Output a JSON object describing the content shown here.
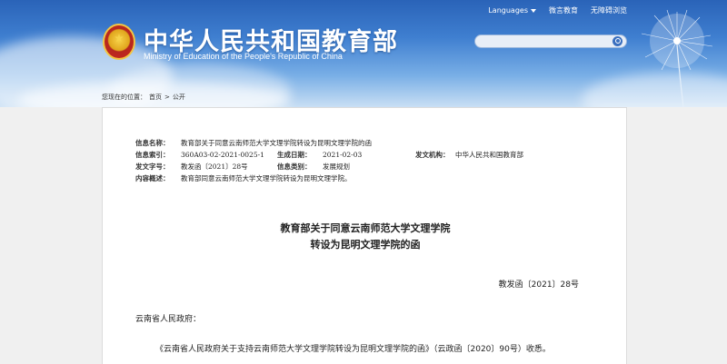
{
  "header": {
    "title": "中华人民共和国教育部",
    "subtitle": "Ministry of Education of the People's Republic of China",
    "links": {
      "languages": "Languages",
      "weibo": "微言教育",
      "accessible": "无障碍浏览"
    },
    "search": {
      "placeholder": ""
    }
  },
  "breadcrumb": {
    "prefix": "您现在的位置：",
    "home": "首页",
    "separator": ">",
    "current": "公开"
  },
  "info": {
    "name_label": "信息名称：",
    "name_value": "教育部关于同意云南师范大学文理学院转设为昆明文理学院的函",
    "index_label": "信息索引：",
    "index_value": "360A03-02-2021-0025-1",
    "date_label": "生成日期：",
    "date_value": "2021-02-03",
    "org_label": "发文机构：",
    "org_value": "中华人民共和国教育部",
    "docno_label": "发文字号：",
    "docno_value": "教发函〔2021〕28号",
    "category_label": "信息类别：",
    "category_value": "发展规划",
    "summary_label": "内容概述：",
    "summary_value": "教育部同意云南师范大学文理学院转设为昆明文理学院。"
  },
  "document": {
    "title_line1": "教育部关于同意云南师范大学文理学院",
    "title_line2": "转设为昆明文理学院的函",
    "number": "教发函〔2021〕28号",
    "salutation": "云南省人民政府：",
    "body_first": "《云南省人民政府关于支持云南师范大学文理学院转设为昆明文理学院的函》（云政函〔2020〕90号）收悉。"
  },
  "colors": {
    "banner_top": "#2a63b8",
    "banner_bottom": "#c9dff4",
    "page_bg": "#f0f0f0"
  }
}
